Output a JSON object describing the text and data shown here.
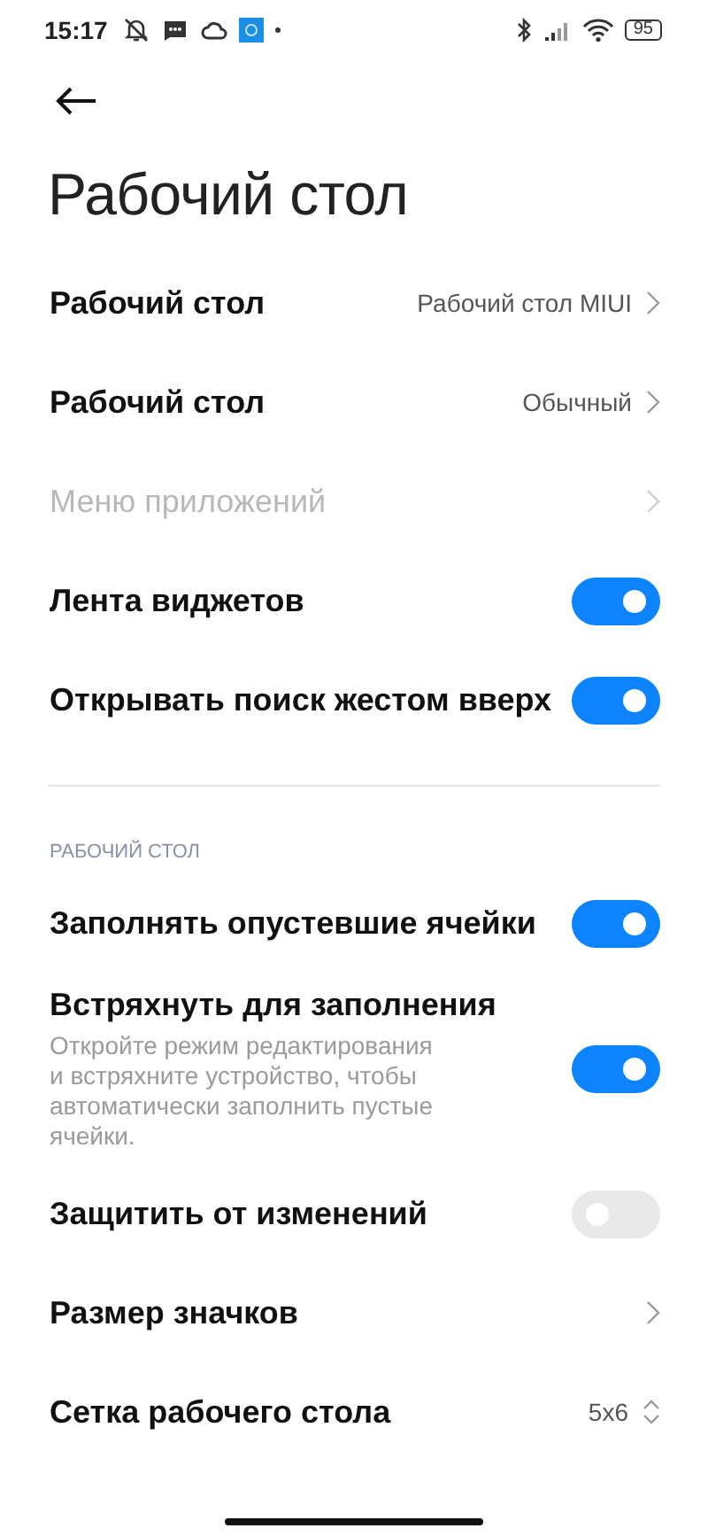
{
  "status_bar": {
    "time": "15:17",
    "battery": "95"
  },
  "title": "Рабочий стол",
  "rows": [
    {
      "kind": "link",
      "label": "Рабочий стол",
      "value": "Рабочий стол MIUI",
      "disabled": false
    },
    {
      "kind": "link",
      "label": "Рабочий стол",
      "value": "Обычный",
      "disabled": false
    },
    {
      "kind": "link",
      "label": "Меню приложений",
      "disabled": true
    },
    {
      "kind": "toggle",
      "label": "Лента виджетов",
      "on": true
    },
    {
      "kind": "toggle",
      "label": "Открывать поиск жестом вверх",
      "on": true
    }
  ],
  "section": {
    "title": "РАБОЧИЙ СТОЛ",
    "rows": [
      {
        "kind": "toggle",
        "label": "Заполнять опустевшие ячейки",
        "on": true
      },
      {
        "kind": "toggle",
        "label": "Встряхнуть для заполнения",
        "description": "Откройте режим редактирования и встряхните устройство, чтобы автоматически заполнить пустые ячейки.",
        "on": true
      },
      {
        "kind": "toggle",
        "label": "Защитить от изменений",
        "on": false
      },
      {
        "kind": "link",
        "label": "Размер значков",
        "disabled": false
      },
      {
        "kind": "stepper",
        "label": "Сетка рабочего стола",
        "value": "5x6"
      }
    ]
  }
}
